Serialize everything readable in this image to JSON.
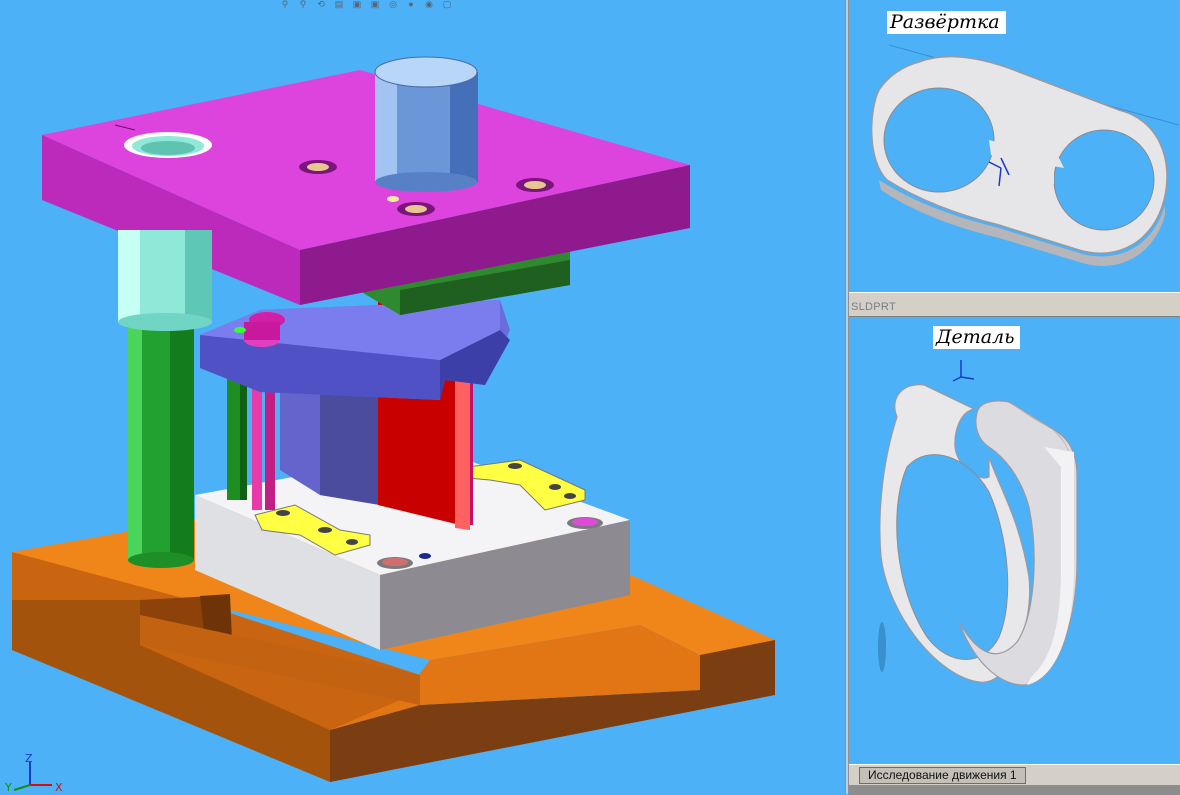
{
  "toolbar": {
    "icons": [
      "zoom-to-fit-icon",
      "zoom-area-icon",
      "previous-view-icon",
      "section-view-icon",
      "view-orientation-icon",
      "display-style-icon",
      "hide-show-icon",
      "appearance-icon",
      "scene-icon",
      "view-settings-icon"
    ]
  },
  "panes": {
    "flat_pattern": {
      "label": "Развёртка"
    },
    "file_type": "SLDPRT",
    "part": {
      "label": "Деталь"
    }
  },
  "bottom": {
    "motion_study_tab": "Исследование движения 1"
  },
  "triad": {
    "z": "Z",
    "y": "Y",
    "x": "X"
  },
  "colors": {
    "background": "#4cb1f7",
    "top_plate": "#d53ed5",
    "base_plate": "#e07a10",
    "stripper_plate": "#6a6cd8",
    "die_block": "#e8e8ea",
    "punch": "#c40000",
    "guide_pillar": "#1a9e2a",
    "guide_bush": "#8fe8d8",
    "shank": "#7aa2e0",
    "stop": "#ffff33"
  }
}
